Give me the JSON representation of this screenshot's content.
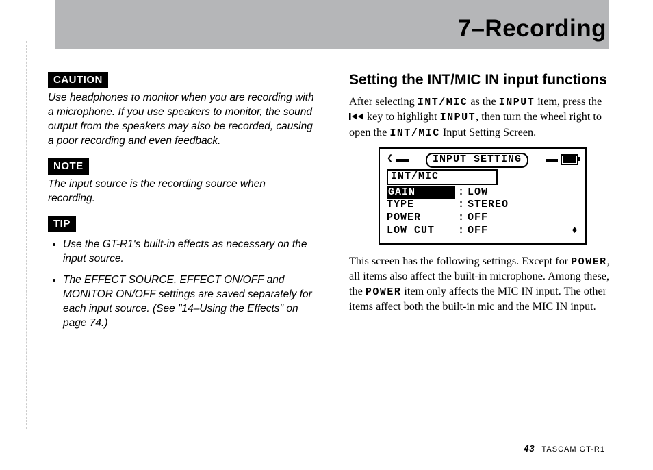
{
  "header": {
    "chapter": "7–Recording"
  },
  "left": {
    "caution": {
      "badge": "CAUTION",
      "text": "Use headphones to monitor when you are recording with a microphone. If you use speakers to monitor, the sound output from the speakers may also be recorded, causing a poor recording and even feedback."
    },
    "note": {
      "badge": "NOTE",
      "text": "The input source is the recording source when recording."
    },
    "tip": {
      "badge": "TIP",
      "items": [
        "Use the GT-R1's built-in effects as necessary on the input source.",
        "The EFFECT SOURCE, EFFECT ON/OFF and MONITOR ON/OFF settings are saved separately for each input source. (See \"14–Using the Effects\" on page 74.)"
      ]
    }
  },
  "right": {
    "section_title": "Setting the INT/MIC IN input functions",
    "para1": {
      "t1": "After selecting ",
      "c1": "INT/MIC",
      "t2": " as the ",
      "c2": "INPUT",
      "t3": " item, press the ",
      "t4": " key to highlight ",
      "c3": "INPUT",
      "t5": ", then turn the wheel right to open the ",
      "c4": "INT/MIC",
      "t6": " Input Setting Screen."
    },
    "lcd": {
      "title": "INPUT SETTING",
      "subheader": "INT/MIC",
      "rows": [
        {
          "label": "GAIN",
          "value": "LOW",
          "highlight": true
        },
        {
          "label": "TYPE",
          "value": "STEREO",
          "highlight": false
        },
        {
          "label": "POWER",
          "value": "OFF",
          "highlight": false
        },
        {
          "label": "LOW CUT",
          "value": "OFF",
          "highlight": false,
          "arrow": true
        }
      ]
    },
    "para2": {
      "t1": "This screen has the following settings. Except for ",
      "c1": "POWER",
      "t2": ", all items also affect the built-in microphone. Among these, the ",
      "c2": "POWER",
      "t3": " item only affects the MIC IN input. The other items affect both the built-in mic and the MIC IN input."
    }
  },
  "footer": {
    "page": "43",
    "product": "TASCAM  GT-R1"
  }
}
